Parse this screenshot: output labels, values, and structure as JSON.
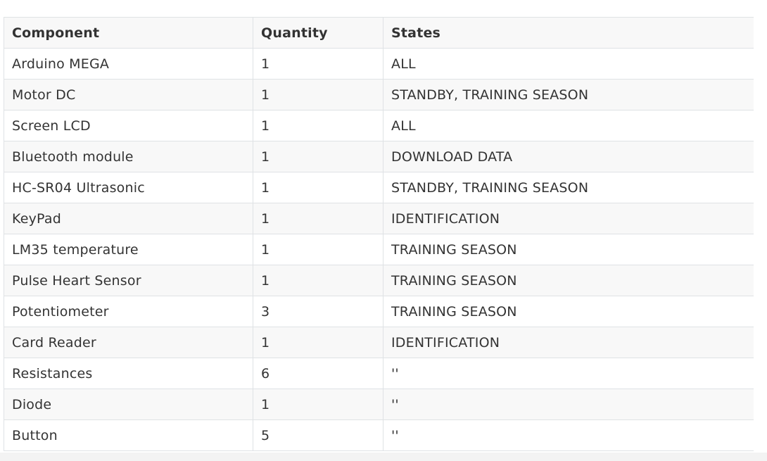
{
  "table": {
    "headers": [
      "Component",
      "Quantity",
      "States"
    ],
    "rows": [
      {
        "component": "Arduino MEGA",
        "quantity": "1",
        "states": "ALL"
      },
      {
        "component": "Motor DC",
        "quantity": "1",
        "states": "STANDBY, TRAINING SEASON"
      },
      {
        "component": "Screen LCD",
        "quantity": "1",
        "states": "ALL"
      },
      {
        "component": "Bluetooth module",
        "quantity": "1",
        "states": "DOWNLOAD DATA"
      },
      {
        "component": "HC-SR04 Ultrasonic",
        "quantity": "1",
        "states": "STANDBY, TRAINING SEASON"
      },
      {
        "component": "KeyPad",
        "quantity": "1",
        "states": "IDENTIFICATION"
      },
      {
        "component": "LM35 temperature",
        "quantity": "1",
        "states": "TRAINING SEASON"
      },
      {
        "component": "Pulse Heart Sensor",
        "quantity": "1",
        "states": "TRAINING SEASON"
      },
      {
        "component": "Potentiometer",
        "quantity": "3",
        "states": "TRAINING SEASON"
      },
      {
        "component": "Card Reader",
        "quantity": "1",
        "states": "IDENTIFICATION"
      },
      {
        "component": "Resistances",
        "quantity": "6",
        "states": "''"
      },
      {
        "component": "Diode",
        "quantity": "1",
        "states": "''"
      },
      {
        "component": "Button",
        "quantity": "5",
        "states": "''"
      }
    ]
  },
  "colors": {
    "border": "#dfe2e5",
    "stripe": "#f8f8f8",
    "text": "#333333"
  }
}
